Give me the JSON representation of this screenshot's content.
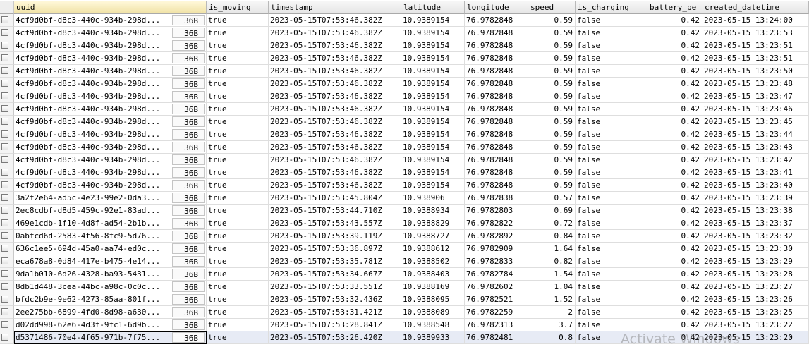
{
  "columns": {
    "uuid": "uuid",
    "is_moving": "is_moving",
    "timestamp": "timestamp",
    "latitude": "latitude",
    "longitude": "longitude",
    "speed": "speed",
    "is_charging": "is_charging",
    "battery_pct": "battery_pe",
    "created_datetime": "created_datetime"
  },
  "rows": [
    {
      "uuid": "4cf9d0bf-d8c3-440c-934b-298d...",
      "size": "36B",
      "is_moving": "true",
      "timestamp": "2023-05-15T07:53:46.382Z",
      "latitude": "10.9389154",
      "longitude": "76.9782848",
      "speed": "0.59",
      "is_charging": "false",
      "battery_pct": "0.42",
      "created_datetime": "2023-05-15 13:24:00"
    },
    {
      "uuid": "4cf9d0bf-d8c3-440c-934b-298d...",
      "size": "36B",
      "is_moving": "true",
      "timestamp": "2023-05-15T07:53:46.382Z",
      "latitude": "10.9389154",
      "longitude": "76.9782848",
      "speed": "0.59",
      "is_charging": "false",
      "battery_pct": "0.42",
      "created_datetime": "2023-05-15 13:23:53"
    },
    {
      "uuid": "4cf9d0bf-d8c3-440c-934b-298d...",
      "size": "36B",
      "is_moving": "true",
      "timestamp": "2023-05-15T07:53:46.382Z",
      "latitude": "10.9389154",
      "longitude": "76.9782848",
      "speed": "0.59",
      "is_charging": "false",
      "battery_pct": "0.42",
      "created_datetime": "2023-05-15 13:23:51"
    },
    {
      "uuid": "4cf9d0bf-d8c3-440c-934b-298d...",
      "size": "36B",
      "is_moving": "true",
      "timestamp": "2023-05-15T07:53:46.382Z",
      "latitude": "10.9389154",
      "longitude": "76.9782848",
      "speed": "0.59",
      "is_charging": "false",
      "battery_pct": "0.42",
      "created_datetime": "2023-05-15 13:23:51"
    },
    {
      "uuid": "4cf9d0bf-d8c3-440c-934b-298d...",
      "size": "36B",
      "is_moving": "true",
      "timestamp": "2023-05-15T07:53:46.382Z",
      "latitude": "10.9389154",
      "longitude": "76.9782848",
      "speed": "0.59",
      "is_charging": "false",
      "battery_pct": "0.42",
      "created_datetime": "2023-05-15 13:23:50"
    },
    {
      "uuid": "4cf9d0bf-d8c3-440c-934b-298d...",
      "size": "36B",
      "is_moving": "true",
      "timestamp": "2023-05-15T07:53:46.382Z",
      "latitude": "10.9389154",
      "longitude": "76.9782848",
      "speed": "0.59",
      "is_charging": "false",
      "battery_pct": "0.42",
      "created_datetime": "2023-05-15 13:23:48"
    },
    {
      "uuid": "4cf9d0bf-d8c3-440c-934b-298d...",
      "size": "36B",
      "is_moving": "true",
      "timestamp": "2023-05-15T07:53:46.382Z",
      "latitude": "10.9389154",
      "longitude": "76.9782848",
      "speed": "0.59",
      "is_charging": "false",
      "battery_pct": "0.42",
      "created_datetime": "2023-05-15 13:23:47"
    },
    {
      "uuid": "4cf9d0bf-d8c3-440c-934b-298d...",
      "size": "36B",
      "is_moving": "true",
      "timestamp": "2023-05-15T07:53:46.382Z",
      "latitude": "10.9389154",
      "longitude": "76.9782848",
      "speed": "0.59",
      "is_charging": "false",
      "battery_pct": "0.42",
      "created_datetime": "2023-05-15 13:23:46"
    },
    {
      "uuid": "4cf9d0bf-d8c3-440c-934b-298d...",
      "size": "36B",
      "is_moving": "true",
      "timestamp": "2023-05-15T07:53:46.382Z",
      "latitude": "10.9389154",
      "longitude": "76.9782848",
      "speed": "0.59",
      "is_charging": "false",
      "battery_pct": "0.42",
      "created_datetime": "2023-05-15 13:23:45"
    },
    {
      "uuid": "4cf9d0bf-d8c3-440c-934b-298d...",
      "size": "36B",
      "is_moving": "true",
      "timestamp": "2023-05-15T07:53:46.382Z",
      "latitude": "10.9389154",
      "longitude": "76.9782848",
      "speed": "0.59",
      "is_charging": "false",
      "battery_pct": "0.42",
      "created_datetime": "2023-05-15 13:23:44"
    },
    {
      "uuid": "4cf9d0bf-d8c3-440c-934b-298d...",
      "size": "36B",
      "is_moving": "true",
      "timestamp": "2023-05-15T07:53:46.382Z",
      "latitude": "10.9389154",
      "longitude": "76.9782848",
      "speed": "0.59",
      "is_charging": "false",
      "battery_pct": "0.42",
      "created_datetime": "2023-05-15 13:23:43"
    },
    {
      "uuid": "4cf9d0bf-d8c3-440c-934b-298d...",
      "size": "36B",
      "is_moving": "true",
      "timestamp": "2023-05-15T07:53:46.382Z",
      "latitude": "10.9389154",
      "longitude": "76.9782848",
      "speed": "0.59",
      "is_charging": "false",
      "battery_pct": "0.42",
      "created_datetime": "2023-05-15 13:23:42"
    },
    {
      "uuid": "4cf9d0bf-d8c3-440c-934b-298d...",
      "size": "36B",
      "is_moving": "true",
      "timestamp": "2023-05-15T07:53:46.382Z",
      "latitude": "10.9389154",
      "longitude": "76.9782848",
      "speed": "0.59",
      "is_charging": "false",
      "battery_pct": "0.42",
      "created_datetime": "2023-05-15 13:23:41"
    },
    {
      "uuid": "4cf9d0bf-d8c3-440c-934b-298d...",
      "size": "36B",
      "is_moving": "true",
      "timestamp": "2023-05-15T07:53:46.382Z",
      "latitude": "10.9389154",
      "longitude": "76.9782848",
      "speed": "0.59",
      "is_charging": "false",
      "battery_pct": "0.42",
      "created_datetime": "2023-05-15 13:23:40"
    },
    {
      "uuid": "3a2f2e64-ad5c-4e23-99e2-0da3...",
      "size": "36B",
      "is_moving": "true",
      "timestamp": "2023-05-15T07:53:45.804Z",
      "latitude": "10.938906",
      "longitude": "76.9782838",
      "speed": "0.57",
      "is_charging": "false",
      "battery_pct": "0.42",
      "created_datetime": "2023-05-15 13:23:39"
    },
    {
      "uuid": "2ec8cdbf-d8d5-459c-92e1-83ad...",
      "size": "36B",
      "is_moving": "true",
      "timestamp": "2023-05-15T07:53:44.710Z",
      "latitude": "10.9388934",
      "longitude": "76.9782803",
      "speed": "0.69",
      "is_charging": "false",
      "battery_pct": "0.42",
      "created_datetime": "2023-05-15 13:23:38"
    },
    {
      "uuid": "469e1cdb-1f10-4d8f-ad54-2b1b...",
      "size": "36B",
      "is_moving": "true",
      "timestamp": "2023-05-15T07:53:43.557Z",
      "latitude": "10.9388829",
      "longitude": "76.9782822",
      "speed": "0.72",
      "is_charging": "false",
      "battery_pct": "0.42",
      "created_datetime": "2023-05-15 13:23:37"
    },
    {
      "uuid": "0abfcd6d-2583-4f56-8fc9-5d76...",
      "size": "36B",
      "is_moving": "true",
      "timestamp": "2023-05-15T07:53:39.119Z",
      "latitude": "10.9388727",
      "longitude": "76.9782892",
      "speed": "0.84",
      "is_charging": "false",
      "battery_pct": "0.42",
      "created_datetime": "2023-05-15 13:23:32"
    },
    {
      "uuid": "636c1ee5-694d-45a0-aa74-ed0c...",
      "size": "36B",
      "is_moving": "true",
      "timestamp": "2023-05-15T07:53:36.897Z",
      "latitude": "10.9388612",
      "longitude": "76.9782909",
      "speed": "1.64",
      "is_charging": "false",
      "battery_pct": "0.42",
      "created_datetime": "2023-05-15 13:23:30"
    },
    {
      "uuid": "eca678a8-0d84-417e-b475-4e14...",
      "size": "36B",
      "is_moving": "true",
      "timestamp": "2023-05-15T07:53:35.781Z",
      "latitude": "10.9388502",
      "longitude": "76.9782833",
      "speed": "0.82",
      "is_charging": "false",
      "battery_pct": "0.42",
      "created_datetime": "2023-05-15 13:23:29"
    },
    {
      "uuid": "9da1b010-6d26-4328-ba93-5431...",
      "size": "36B",
      "is_moving": "true",
      "timestamp": "2023-05-15T07:53:34.667Z",
      "latitude": "10.9388403",
      "longitude": "76.9782784",
      "speed": "1.54",
      "is_charging": "false",
      "battery_pct": "0.42",
      "created_datetime": "2023-05-15 13:23:28"
    },
    {
      "uuid": "8db1d448-3cea-44bc-a98c-0c0c...",
      "size": "36B",
      "is_moving": "true",
      "timestamp": "2023-05-15T07:53:33.551Z",
      "latitude": "10.9388169",
      "longitude": "76.9782602",
      "speed": "1.04",
      "is_charging": "false",
      "battery_pct": "0.42",
      "created_datetime": "2023-05-15 13:23:27"
    },
    {
      "uuid": "bfdc2b9e-9e62-4273-85aa-801f...",
      "size": "36B",
      "is_moving": "true",
      "timestamp": "2023-05-15T07:53:32.436Z",
      "latitude": "10.9388095",
      "longitude": "76.9782521",
      "speed": "1.52",
      "is_charging": "false",
      "battery_pct": "0.42",
      "created_datetime": "2023-05-15 13:23:26"
    },
    {
      "uuid": "2ee275bb-6899-4fd0-8d98-a630...",
      "size": "36B",
      "is_moving": "true",
      "timestamp": "2023-05-15T07:53:31.421Z",
      "latitude": "10.9388089",
      "longitude": "76.9782259",
      "speed": "2",
      "is_charging": "false",
      "battery_pct": "0.42",
      "created_datetime": "2023-05-15 13:23:25"
    },
    {
      "uuid": "d02dd998-62e6-4d3f-9fc1-6d9b...",
      "size": "36B",
      "is_moving": "true",
      "timestamp": "2023-05-15T07:53:28.841Z",
      "latitude": "10.9388548",
      "longitude": "76.9782313",
      "speed": "3.7",
      "is_charging": "false",
      "battery_pct": "0.42",
      "created_datetime": "2023-05-15 13:23:22"
    },
    {
      "uuid": "d5371486-70e4-4f65-971b-7f75...",
      "size": "36B",
      "is_moving": "true",
      "timestamp": "2023-05-15T07:53:26.420Z",
      "latitude": "10.9389933",
      "longitude": "76.9782481",
      "speed": "0.8",
      "is_charging": "false",
      "battery_pct": "0.42",
      "created_datetime": "2023-05-15 13:23:20"
    }
  ],
  "watermark": "Activate Windows"
}
